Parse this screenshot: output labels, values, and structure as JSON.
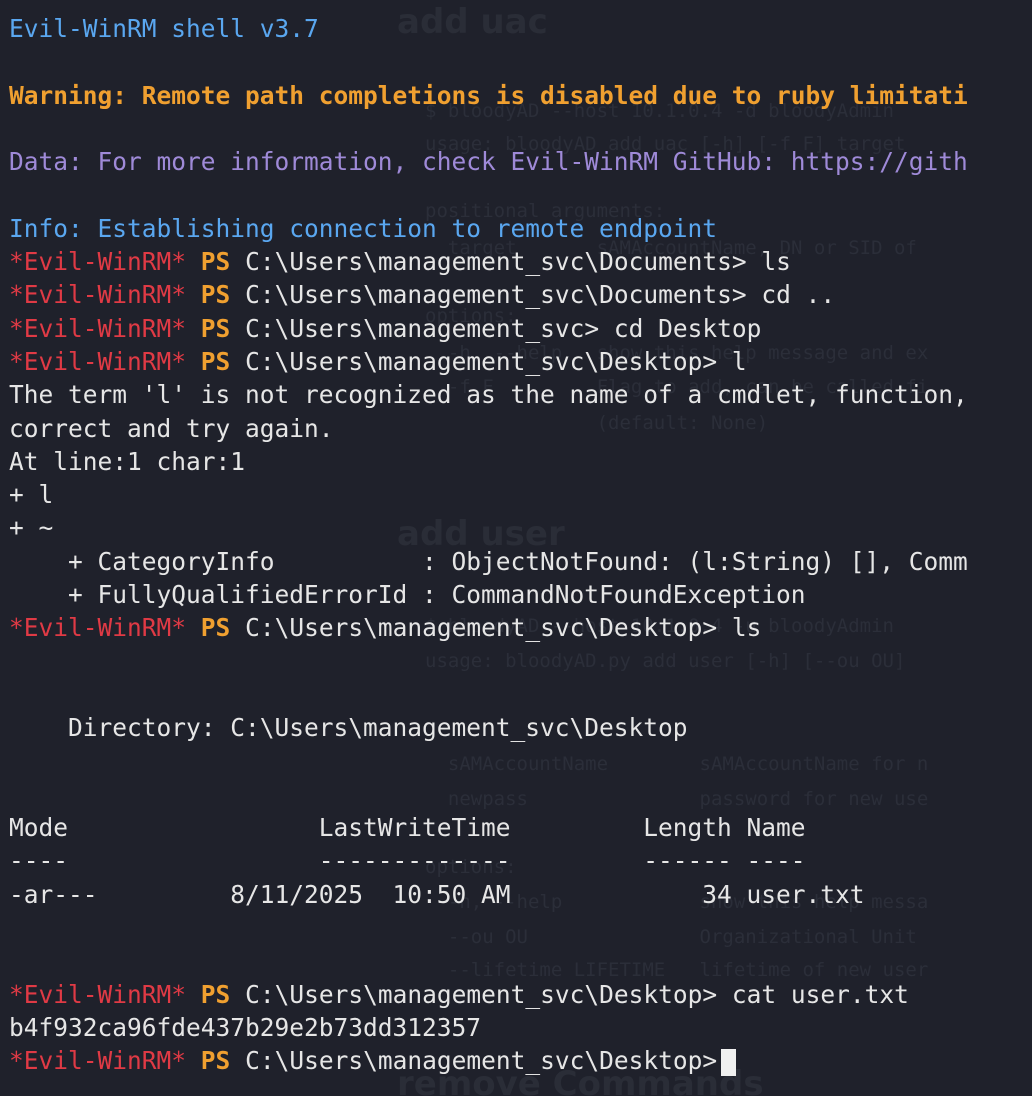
{
  "banner": {
    "shell": "Evil-WinRM shell v3.7",
    "warning": "Warning: Remote path completions is disabled due to ruby limitati",
    "data": "Data: For more information, check Evil-WinRM GitHub: https://gith",
    "info": "Info: Establishing connection to remote endpoint"
  },
  "prompt": {
    "label": "*Evil-WinRM*",
    "ps": "PS"
  },
  "commands": [
    {
      "path": "C:\\Users\\management_svc\\Documents>",
      "cmd": " ls"
    },
    {
      "path": "C:\\Users\\management_svc\\Documents>",
      "cmd": " cd .."
    },
    {
      "path": "C:\\Users\\management_svc>",
      "cmd": " cd Desktop"
    },
    {
      "path": "C:\\Users\\management_svc\\Desktop>",
      "cmd": " l"
    },
    {
      "path": "C:\\Users\\management_svc\\Desktop>",
      "cmd": " ls"
    },
    {
      "path": "C:\\Users\\management_svc\\Desktop>",
      "cmd": " cat user.txt"
    },
    {
      "path": "C:\\Users\\management_svc\\Desktop>",
      "cmd": ""
    }
  ],
  "error": {
    "line1": "The term 'l' is not recognized as the name of a cmdlet, function,",
    "line2": "correct and try again.",
    "line3": "At line:1 char:1",
    "line4": "+ l",
    "line5": "+ ~",
    "line6": "    + CategoryInfo          : ObjectNotFound: (l:String) [], Comm",
    "line7": "    + FullyQualifiedErrorId : CommandNotFoundException"
  },
  "listing": {
    "directory": "    Directory: C:\\Users\\management_svc\\Desktop",
    "header": "Mode                 LastWriteTime         Length Name",
    "underline": "----                 -------------         ------ ----",
    "row": "-ar---         8/11/2025  10:50 AM             34 user.txt"
  },
  "output": {
    "flag": "b4f932ca96fde437b29e2b73dd312357"
  },
  "background_notes": {
    "h1": "add uac",
    "l1": "$ bloodyAD --host 10.1.0.4 -d bloodyAdmin",
    "l2": "usage: bloodyAD add uac [-h] [-f F] target",
    "l3": "positional arguments:",
    "l4": "  target       sAMAccountName, DN or SID of",
    "l5": "options:",
    "l6": "  -h, --help   show this help message and ex",
    "l7": "  -f F         Flag to add, can be called fi",
    "l8": "               (default: None)",
    "h2": "add user",
    "l9": "$ bloodyAD --host 10.1.0.4 -u bloodyAdmin",
    "l10": "usage: bloodyAD.py add user [-h] [--ou OU]",
    "l11": "  sAMAccountName        sAMAccountName for n",
    "l12": "  newpass               password for new use",
    "l13": "options:",
    "l14": "  -h, --help            show this help messa",
    "l15": "  --ou OU               Organizational Unit",
    "l16": "  --lifetime LIFETIME   lifetime of new user",
    "h3": "remove Commands"
  }
}
